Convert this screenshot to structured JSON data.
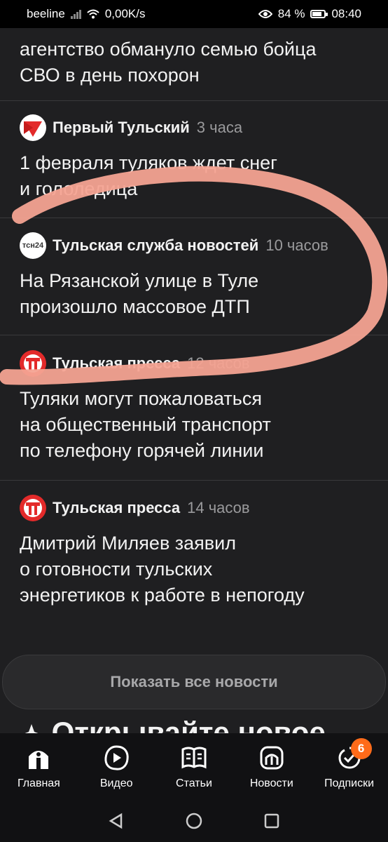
{
  "status": {
    "carrier": "beeline",
    "speed": "0,00K/s",
    "battery": "84 %",
    "battery_level": 0.84,
    "time": "08:40"
  },
  "feed": {
    "partial_headline": [
      "агентство обмануло семью бойца",
      "СВО в день похорон"
    ],
    "items": [
      {
        "source": "Первый Тульский",
        "time": "3 часа",
        "logo": "pervy-tulsky-logo",
        "headline": [
          "1 февраля туляков ждет снег",
          "и гололедица"
        ]
      },
      {
        "source": "Тульская служба новостей",
        "time": "10 часов",
        "logo": "tsn24-logo",
        "logo_text": "тсн24",
        "headline": [
          "На Рязанской улице в Туле",
          "произошло массовое ДТП"
        ]
      },
      {
        "source": "Тульская пресса",
        "time": "12 часов",
        "logo": "tulskaya-pressa-logo",
        "headline": [
          "Туляки могут пожаловаться",
          "на общественный транспорт",
          "по телефону горячей линии"
        ]
      },
      {
        "source": "Тульская пресса",
        "time": "14 часов",
        "logo": "tulskaya-pressa-logo",
        "headline": [
          "Дмитрий Миляев заявил",
          "о готовности тульских",
          "энергетиков к работе в непогоду"
        ]
      }
    ],
    "show_all_label": "Показать все новости",
    "next_section_title": "Открывайте новое"
  },
  "tabs": [
    {
      "label": "Главная",
      "icon": "home-icon"
    },
    {
      "label": "Видео",
      "icon": "play-icon"
    },
    {
      "label": "Статьи",
      "icon": "articles-icon"
    },
    {
      "label": "Новости",
      "icon": "news-icon"
    },
    {
      "label": "Подписки",
      "icon": "subscriptions-icon",
      "badge": "6"
    }
  ],
  "colors": {
    "accent_badge": "#ff6b1a",
    "scribble": "#f4a392",
    "background": "#1f1f21"
  }
}
